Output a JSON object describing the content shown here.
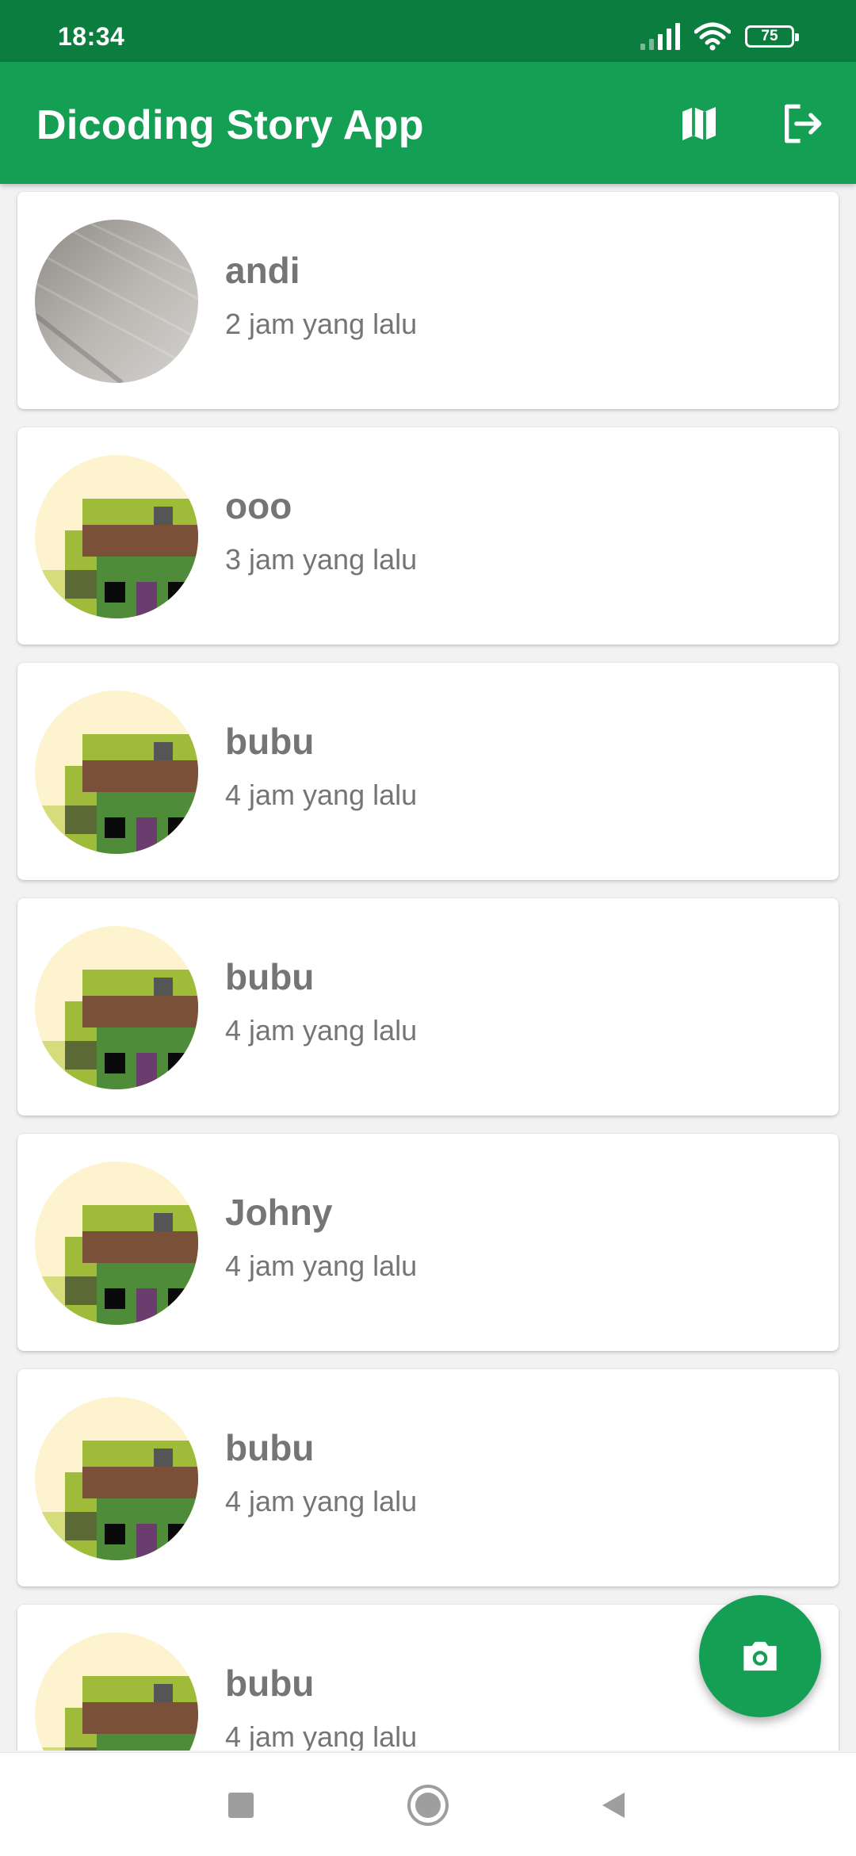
{
  "status_bar": {
    "time": "18:34",
    "battery": "75"
  },
  "app_bar": {
    "title": "Dicoding Story App",
    "icons": [
      "map-icon",
      "logout-icon"
    ]
  },
  "stories": [
    {
      "name": "andi",
      "time": "2 jam yang lalu",
      "avatar": "photo"
    },
    {
      "name": "ooo",
      "time": "3 jam yang lalu",
      "avatar": "pixel"
    },
    {
      "name": "bubu",
      "time": "4 jam yang lalu",
      "avatar": "pixel"
    },
    {
      "name": "bubu",
      "time": "4 jam yang lalu",
      "avatar": "pixel"
    },
    {
      "name": "Johny",
      "time": "4 jam yang lalu",
      "avatar": "pixel"
    },
    {
      "name": "bubu",
      "time": "4 jam yang lalu",
      "avatar": "pixel"
    },
    {
      "name": "bubu",
      "time": "4 jam yang lalu",
      "avatar": "pixel"
    }
  ],
  "fab": {
    "icon": "camera-icon"
  },
  "nav_bar": {
    "icons": [
      "recents-icon",
      "home-icon",
      "back-icon"
    ]
  },
  "colors": {
    "primary": "#149f55",
    "status": "#0b7d3e",
    "text_secondary": "#757575"
  }
}
